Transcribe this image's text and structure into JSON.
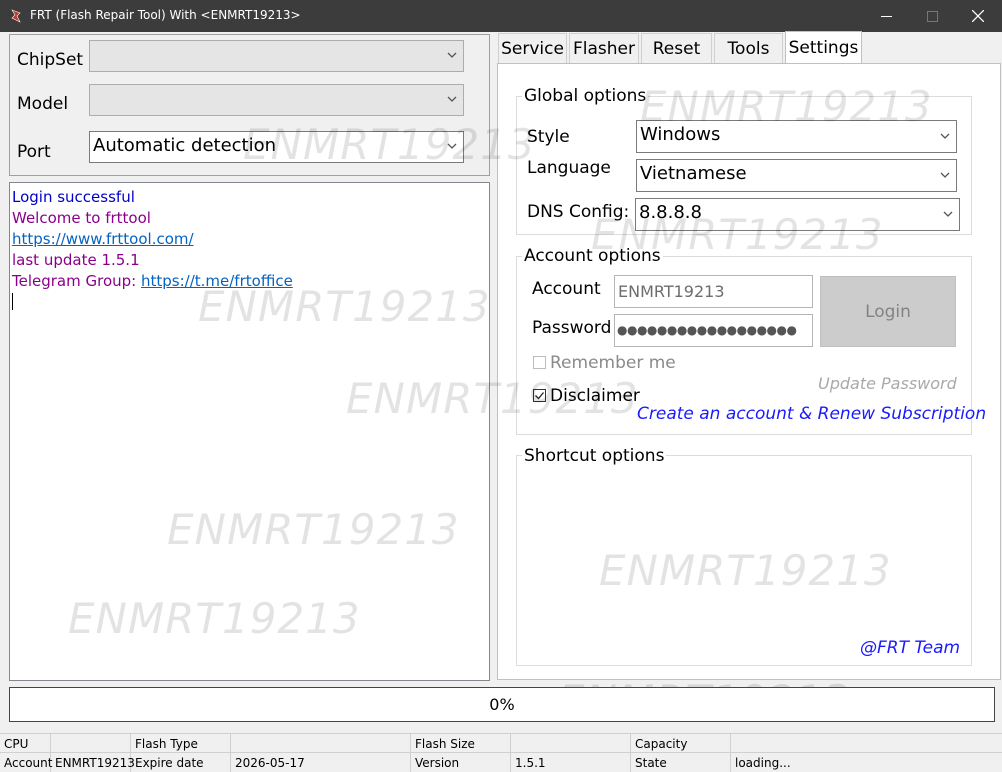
{
  "window": {
    "title": "FRT (Flash Repair Tool)   With <ENMRT19213>"
  },
  "left": {
    "chipset_label": "ChipSet",
    "chipset_value": "",
    "model_label": "Model",
    "model_value": "",
    "port_label": "Port",
    "port_value": "Automatic detection"
  },
  "log": {
    "lines": [
      {
        "text": "Login successful"
      },
      {
        "text": "Welcome to frttool"
      },
      {
        "text": "https://www.frttool.com/"
      },
      {
        "text": "last update 1.5.1"
      },
      {
        "prefix": "Telegram Group: ",
        "link": "https://t.me/frtoffice"
      }
    ]
  },
  "tabs": [
    {
      "label": "Service"
    },
    {
      "label": "Flasher"
    },
    {
      "label": "Reset"
    },
    {
      "label": "Tools"
    },
    {
      "label": "Settings",
      "active": true
    }
  ],
  "settings": {
    "global": {
      "title": "Global options",
      "style_label": "Style",
      "style_value": "Windows",
      "language_label": "Language",
      "language_value": "Vietnamese",
      "dns_label": "DNS Config:",
      "dns_value": "8.8.8.8"
    },
    "account": {
      "title": "Account options",
      "account_label": "Account",
      "account_value": "ENMRT19213",
      "password_label": "Password",
      "password_mask": "●●●●●●●●●●●●●●●●●●",
      "login_button": "Login",
      "remember_label": "Remember me",
      "remember_checked": false,
      "disclaimer_label": "Disclaimer",
      "disclaimer_checked": true,
      "update_password": "Update Password",
      "create_account": "Create an account & Renew Subscription"
    },
    "shortcut": {
      "title": "Shortcut options",
      "team": "@FRT Team"
    }
  },
  "watermark": "ENMRT19213",
  "progress": {
    "value": 0,
    "label": "0%"
  },
  "statusbar": {
    "row1": [
      {
        "text": "CPU"
      },
      {
        "text": ""
      },
      {
        "text": "Flash Type"
      },
      {
        "text": ""
      },
      {
        "text": "Flash Size"
      },
      {
        "text": ""
      },
      {
        "text": "Capacity"
      },
      {
        "text": ""
      }
    ],
    "row2": [
      {
        "text": "Account"
      },
      {
        "text": "ENMRT19213"
      },
      {
        "text": "Expire date"
      },
      {
        "text": "2026-05-17"
      },
      {
        "text": "Version"
      },
      {
        "text": "1.5.1"
      },
      {
        "text": "State"
      },
      {
        "text": "loading..."
      }
    ]
  },
  "colors": {
    "titlebar": "#3c3c3c",
    "log_blue": "#0000cc",
    "log_purple": "#8b008b",
    "link": "#0563c1",
    "create_link": "#1a1aff"
  }
}
